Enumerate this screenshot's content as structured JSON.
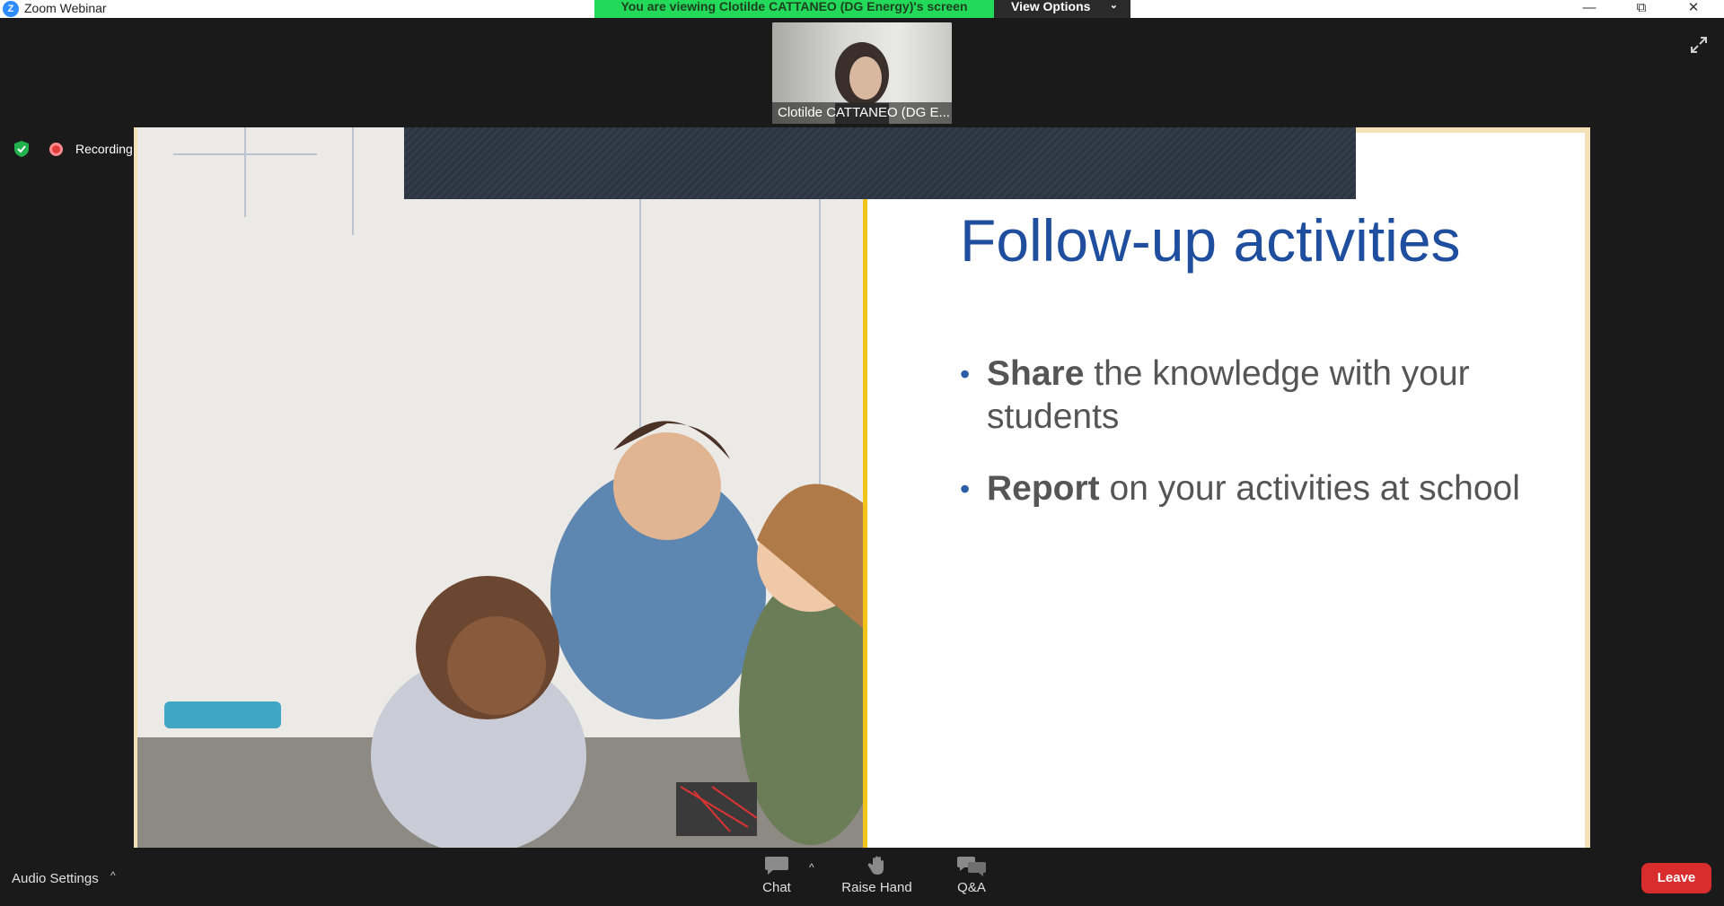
{
  "window": {
    "logo_glyph": "Z",
    "title": "Zoom Webinar",
    "minimize_glyph": "—",
    "restore_glyph": "⧉",
    "close_glyph": "✕"
  },
  "banner": {
    "viewing_text": "You are viewing Clotilde CATTANEO (DG Energy)'s screen",
    "view_options_label": "View Options",
    "view_options_chevron": "⌄",
    "color": "#23d959"
  },
  "video": {
    "participant_name": "Clotilde CATTANEO (DG E..."
  },
  "status": {
    "recording_label": "Recording",
    "secure_icon": "shield-check-icon"
  },
  "slide": {
    "title": "Follow-up activities",
    "bullets": [
      {
        "marker": "•",
        "bold": "Share",
        "rest": " the knowledge with your students"
      },
      {
        "marker": "•",
        "bold": "Report",
        "rest": " on your activities at school"
      }
    ],
    "title_color": "#1f4e9e",
    "accent_color": "#f2c419"
  },
  "toolbar": {
    "audio_settings_label": "Audio Settings",
    "audio_caret": "^",
    "chat_label": "Chat",
    "chat_caret": "^",
    "raise_hand_label": "Raise Hand",
    "qa_label": "Q&A",
    "leave_label": "Leave",
    "leave_color": "#d92d2d"
  }
}
